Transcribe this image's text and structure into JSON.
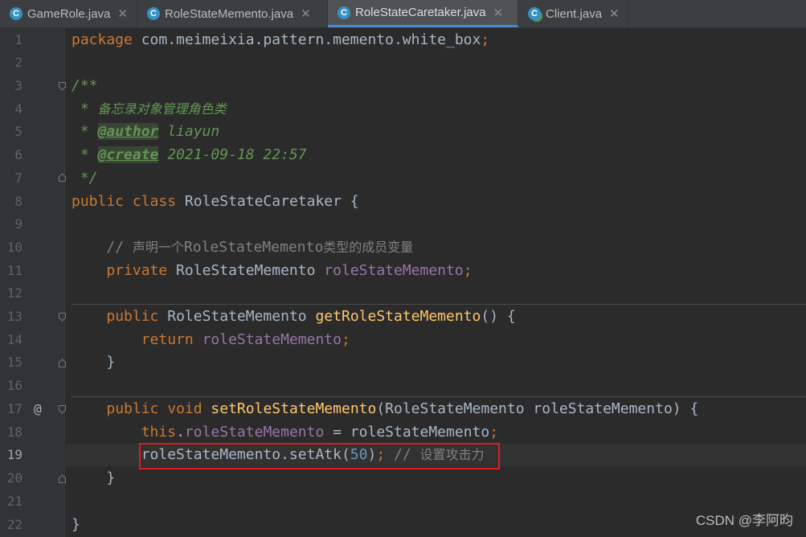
{
  "tabs": [
    {
      "label": "GameRole.java",
      "icon": "class-icon"
    },
    {
      "label": "RoleStateMemento.java",
      "icon": "class-icon"
    },
    {
      "label": "RoleStateCaretaker.java",
      "icon": "class-icon",
      "active": true
    },
    {
      "label": "Client.java",
      "icon": "runnable-class-icon"
    }
  ],
  "tab_close_glyph": "✕",
  "tab_icon_letter": "C",
  "gutter": {
    "line_numbers": [
      "1",
      "2",
      "3",
      "4",
      "5",
      "6",
      "7",
      "8",
      "9",
      "10",
      "11",
      "12",
      "13",
      "14",
      "15",
      "16",
      "17",
      "18",
      "19",
      "20",
      "21",
      "22"
    ],
    "current_line": "19",
    "override_marker": "@"
  },
  "code": {
    "l1_kw": "package",
    "l1_rest": " com.meimeixia.pattern.memento.white_box",
    "l1_semi": ";",
    "l3": "/**",
    "l4_star": " * ",
    "l4_text": "备忘录对象管理角色类",
    "l5_star": " * ",
    "l5_tag": "@author",
    "l5_val": " liayun",
    "l6_star": " * ",
    "l6_tag": "@create",
    "l6_val": " 2021-09-18 22:57",
    "l7": " */",
    "l8_kw1": "public",
    "l8_kw2": " class",
    "l8_rest": " RoleStateCaretaker {",
    "l10_indent": "    ",
    "l10_slashes": "// ",
    "l10_cjk1": "声明一个",
    "l10_type": "RoleStateMemento",
    "l10_cjk2": "类型的成员变量",
    "l11_indent": "    ",
    "l11_kw": "private",
    "l11_type": " RoleStateMemento ",
    "l11_field": "roleStateMemento",
    "l11_semi": ";",
    "l13_indent": "    ",
    "l13_kw": "public",
    "l13_type": " RoleStateMemento ",
    "l13_fn": "getRoleStateMemento",
    "l13_rest": "() {",
    "l14_indent": "        ",
    "l14_kw": "return",
    "l14_sp": " ",
    "l14_field": "roleStateMemento",
    "l14_semi": ";",
    "l15": "    }",
    "l17_indent": "    ",
    "l17_kw1": "public",
    "l17_kw2": " void",
    "l17_sp": " ",
    "l17_fn": "setRoleStateMemento",
    "l17_rest": "(RoleStateMemento roleStateMemento) {",
    "l18_indent": "        ",
    "l18_kw": "this",
    "l18_dot": ".",
    "l18_field": "roleStateMemento",
    "l18_rest": " = roleStateMemento",
    "l18_semi": ";",
    "l19_indent": "        ",
    "l19_call": "roleStateMemento.setAtk(",
    "l19_num": "50",
    "l19_close": ")",
    "l19_semi": ";",
    "l19_slashes": " // ",
    "l19_cjk": "设置攻击力",
    "l20": "    }",
    "l22": "}"
  },
  "watermark": "CSDN @李阿昀",
  "colors": {
    "editor_bg": "#2b2b2b",
    "keyword": "#cc7832",
    "method": "#ffc66d",
    "field": "#9876aa",
    "number": "#6897bb",
    "doc_comment": "#629755",
    "highlight_box": "#e21b1b"
  }
}
